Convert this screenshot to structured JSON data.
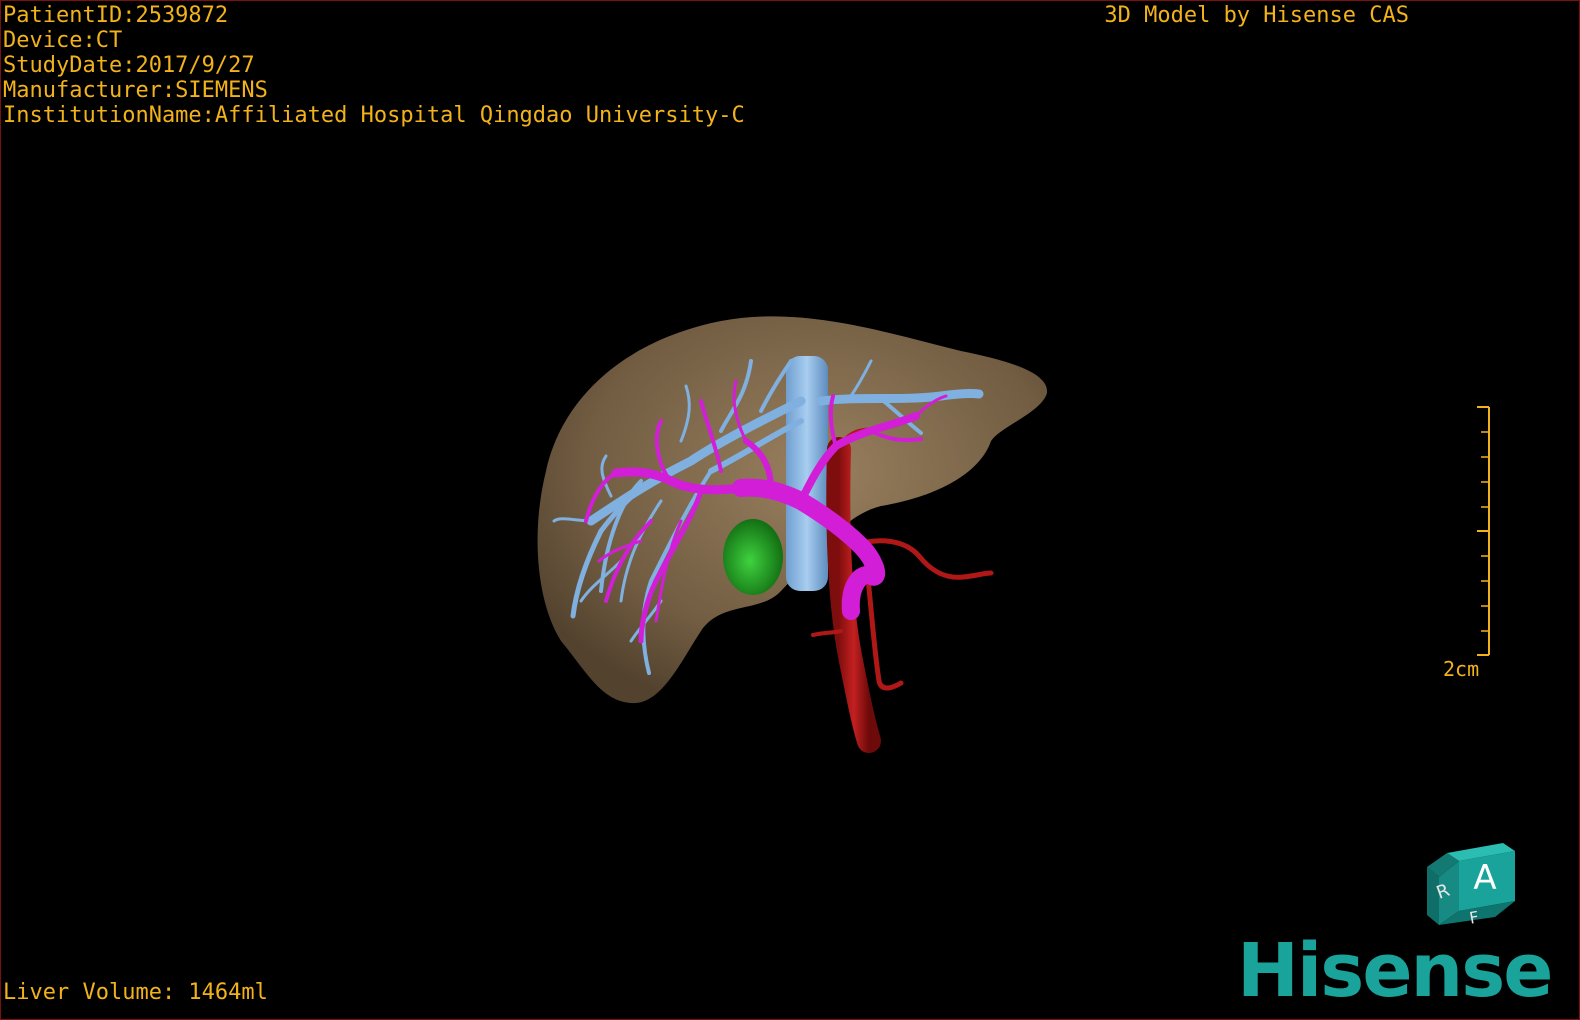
{
  "header": {
    "patient_id": "PatientID:2539872",
    "device": "Device:CT",
    "study_date": "StudyDate:2017/9/27",
    "manufacturer": "Manufacturer:SIEMENS",
    "institution": "InstitutionName:Affiliated Hospital Qingdao University-C",
    "model_credit": "3D Model by Hisense CAS"
  },
  "footer": {
    "liver_volume": "Liver Volume: 1464ml"
  },
  "scale": {
    "label": "2cm"
  },
  "orientation_cube": {
    "face_front": "A",
    "face_side": "R",
    "face_bottom": "F"
  },
  "brand": {
    "logo_text": "Hisense"
  },
  "colors": {
    "overlay_text": "#f2b21b",
    "liver": "#8a7355",
    "hepatic_vein": "#7fb0e0",
    "portal_vein": "#d21ed6",
    "artery": "#b01818",
    "gallbladder": "#1f9e1f",
    "brand": "#1aa39a",
    "cube": "#1aa39a"
  },
  "icons": {
    "orientation": "orientation-cube-icon",
    "scale": "scale-bar-icon"
  }
}
